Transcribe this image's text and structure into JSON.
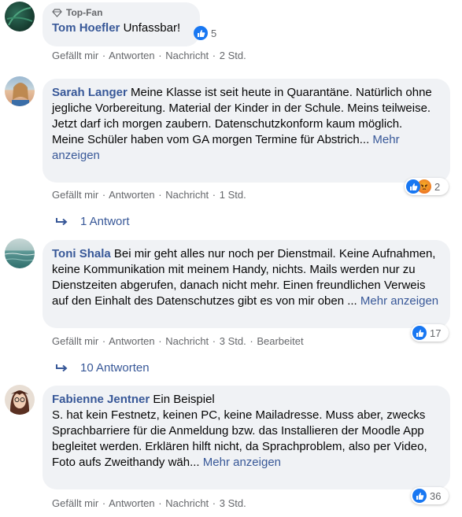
{
  "actions": {
    "like": "Gefällt mir",
    "reply": "Antworten",
    "message": "Nachricht",
    "dot": "·"
  },
  "comments": [
    {
      "badge": "Top-Fan",
      "author": "Tom Hoefler",
      "text": "Unfassbar!",
      "reactions": "5",
      "time": "2 Std."
    },
    {
      "author": "Sarah Langer",
      "text": "Meine Klasse ist seit heute in Quarantäne. Natürlich ohne jegliche Vorbereitung. Material der Kinder in der Schule. Meins teilweise. Jetzt darf ich morgen zaubern. Datenschutzkonform kaum möglich.",
      "text2": "Meine Schüler haben vom GA morgen Termine für Abstrich...",
      "more": "Mehr anzeigen",
      "reactions": "2",
      "time": "1 Std.",
      "replies": "1 Antwort"
    },
    {
      "author": "Toni Shala",
      "text": "Bei mir geht alles nur noch per Dienstmail. Keine Aufnahmen, keine Kommunikation mit meinem Handy, nichts. Mails werden nur zu Dienstzeiten abgerufen, danach nicht mehr. Einen freundlichen Verweis auf den Einhalt des Datenschutzes gibt es von mir oben ...",
      "more": "Mehr anzeigen",
      "reactions": "17",
      "time": "3 Std.",
      "edited": "Bearbeitet",
      "replies": "10 Antworten"
    },
    {
      "author": "Fabienne Jentner",
      "text": "Ein Beispiel",
      "text2": "S. hat kein Festnetz, keinen PC, keine Mailadresse. Muss aber, zwecks Sprachbarriere für die Anmeldung bzw. das Installieren der Moodle App begleitet werden. Erklären hilft nicht, da Sprachproblem, also per Video, Foto aufs Zweithandy wäh...",
      "more": "Mehr anzeigen",
      "reactions": "36",
      "time": "3 Std."
    }
  ],
  "colors": {
    "link": "#385898",
    "bubble": "#f0f2f5",
    "like": "#1877f2",
    "meta": "#65676b"
  },
  "icons": [
    "diamond-icon",
    "like-icon",
    "angry-icon",
    "reply-arrow-icon"
  ]
}
